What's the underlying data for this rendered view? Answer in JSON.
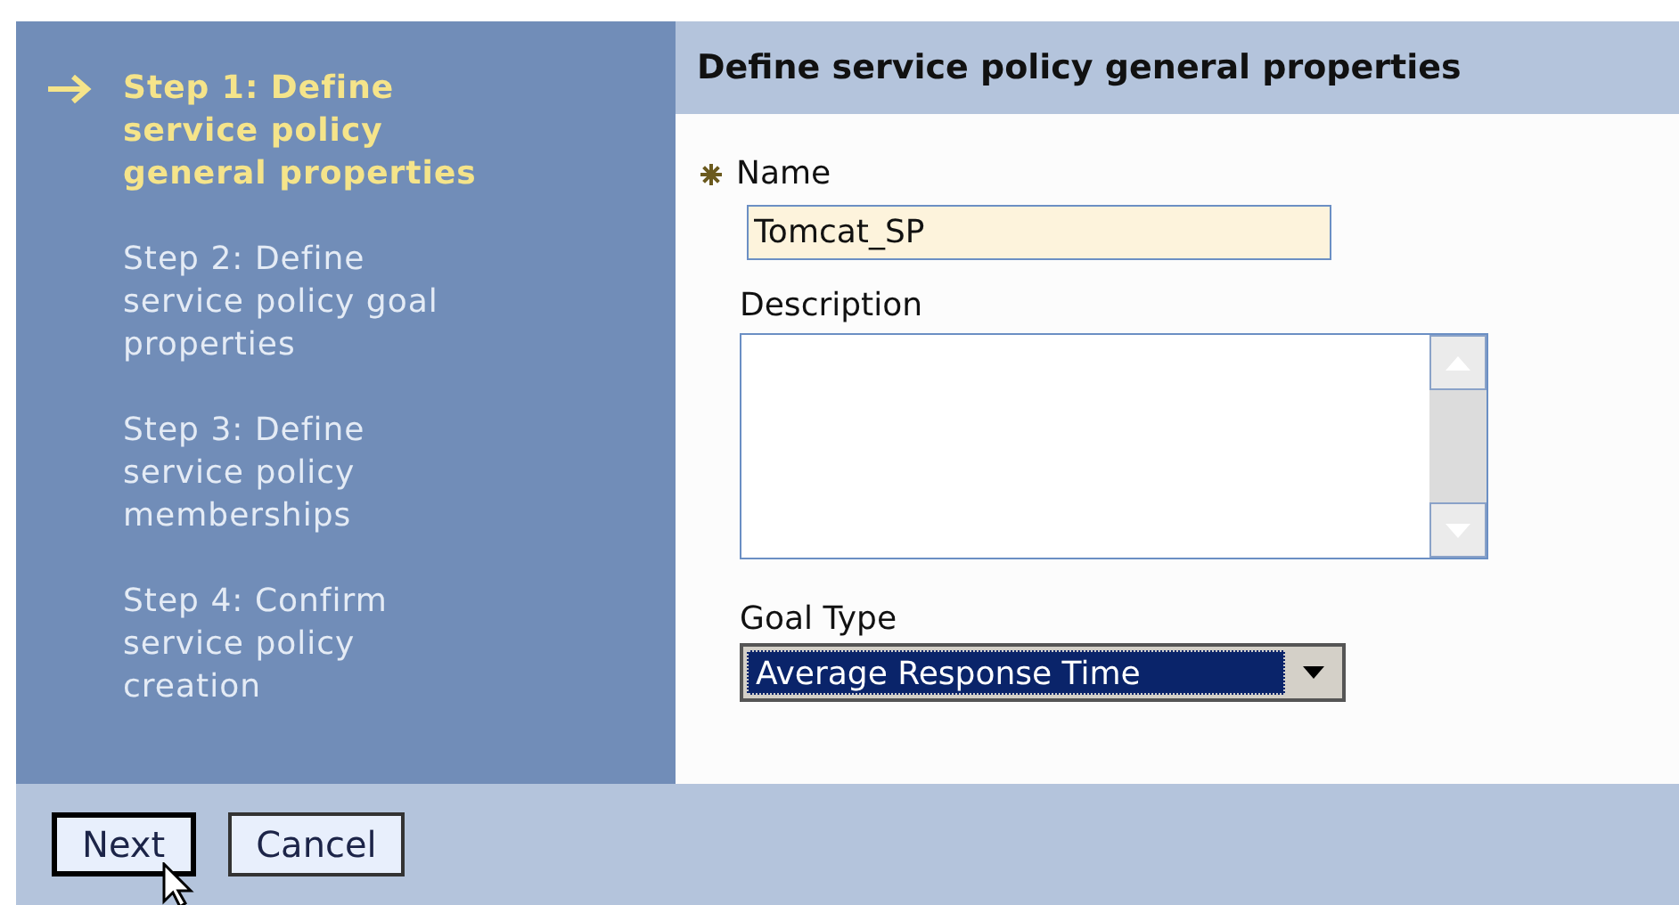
{
  "steps": [
    {
      "label": "Step 1: Define service policy general properties",
      "selected": true
    },
    {
      "label": "Step 2: Define service policy goal properties",
      "selected": false
    },
    {
      "label": "Step 3: Define service policy memberships",
      "selected": false
    },
    {
      "label": "Step 4: Confirm service policy creation",
      "selected": false
    }
  ],
  "panel": {
    "title": "Define service policy general properties",
    "name_field": {
      "label": "Name",
      "required": true,
      "value": "Tomcat_SP"
    },
    "description_field": {
      "label": "Description"
    },
    "goal_type": {
      "label": "Goal Type",
      "value": "Average Response Time"
    }
  },
  "buttons": [
    {
      "label": "Next",
      "focused": true
    },
    {
      "label": "Cancel",
      "focused": false
    }
  ]
}
